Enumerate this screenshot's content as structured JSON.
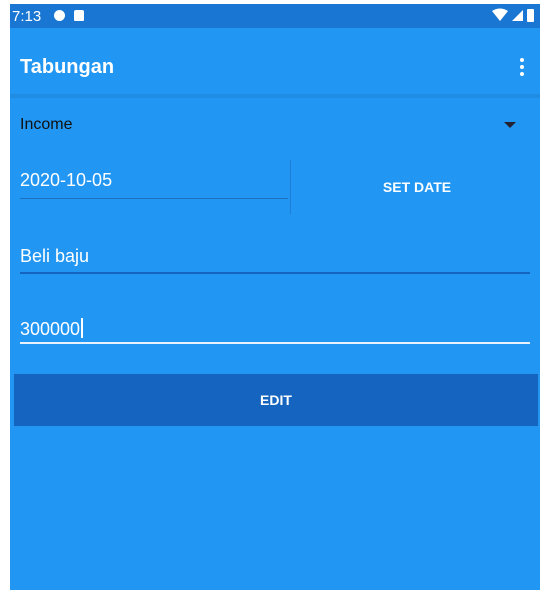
{
  "status_bar": {
    "time": "7:13",
    "icons": [
      "circle-app-icon",
      "sd-card-icon",
      "wifi-icon",
      "signal-icon",
      "battery-icon"
    ]
  },
  "app_bar": {
    "title": "Tabungan",
    "menu_icon": "more-vert-icon"
  },
  "form": {
    "type_select": {
      "value": "Income"
    },
    "date": {
      "value": "2020-10-05",
      "button_label": "SET DATE"
    },
    "description": {
      "value": "Beli baju"
    },
    "amount": {
      "value": "300000"
    },
    "submit_label": "EDIT"
  },
  "colors": {
    "primary": "#2196F3",
    "primary_dark": "#1976D2",
    "button": "#1565C0"
  }
}
